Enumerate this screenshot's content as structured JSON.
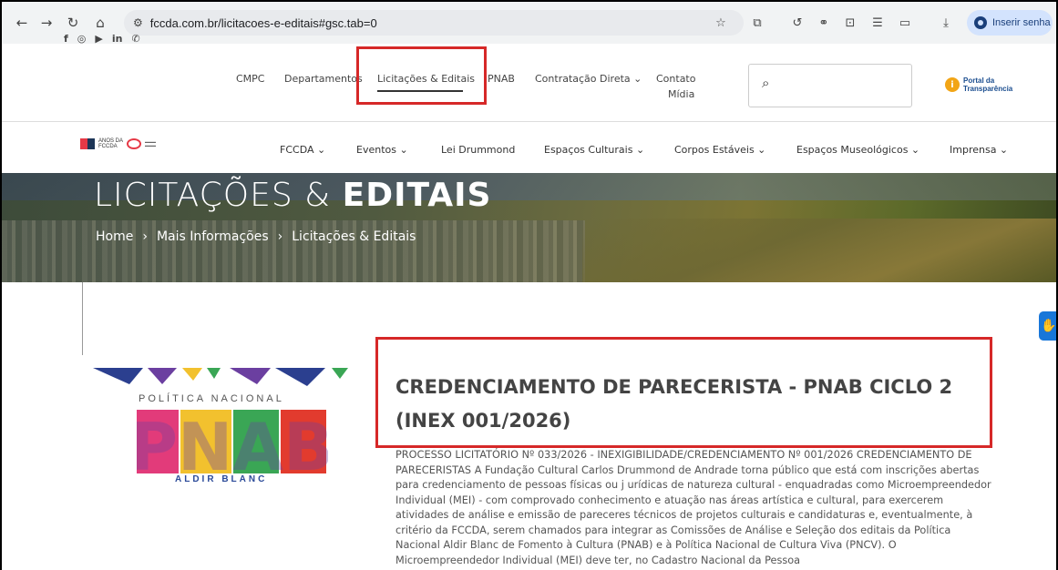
{
  "browser": {
    "url": "fccda.com.br/licitacoes-e-editais#gsc.tab=0",
    "password_button": "Inserir senha"
  },
  "header": {
    "top_links": [
      "CMPC",
      "Departamentos",
      "Licitações & Editais",
      "PNAB",
      "Contratação Direta",
      "Contato",
      "Mídia"
    ],
    "portal_line1": "Portal da",
    "portal_line2": "Transparência"
  },
  "logo": {
    "line1": "ANOS DA",
    "line2": "FCCDA"
  },
  "nav": {
    "items": [
      "FCCDA",
      "Eventos",
      "Lei Drummond",
      "Espaços Culturais",
      "Corpos Estáveis",
      "Espaços Museológicos",
      "Imprensa"
    ]
  },
  "hero": {
    "title_light": "LICITAÇÕES &",
    "title_bold": "EDITAIS",
    "breadcrumb": [
      "Home",
      "Mais Informações",
      "Licitações & Editais"
    ],
    "sep": "›"
  },
  "post": {
    "image_top": "POLÍTICA NACIONAL",
    "image_main": "PNAB",
    "image_sub": "ALDIR BLANC",
    "title": "CREDENCIAMENTO DE PARECERISTA - PNAB CICLO 2 (INEX 001/2026)",
    "body": "PROCESSO LICITATÓRIO Nº 033/2026 - INEXIGIBILIDADE/CREDENCIAMENTO Nº 001/2026 CREDENCIAMENTO DE PARECERISTAS A Fundação Cultural Carlos Drummond de Andrade torna público que está com inscrições abertas para credenciamento de pessoas físicas ou j urídicas de natureza cultural - enquadradas como Microempreendedor Individual (MEI) - com comprovado conhecimento e atuação nas áreas artística e cultural, para exercerem atividades de análise e emissão de pareceres técnicos de projetos culturais e candidaturas e, eventualmente, à critério da FCCDA, serem chamados para integrar as Comissões de Análise e Seleção dos editais da Política Nacional Aldir Blanc de Fomento à Cultura (PNAB) e à Política Nacional de Cultura Viva (PNCV). O Microempreendedor Individual (MEI) deve ter, no Cadastro Nacional da Pessoa"
  },
  "colors": {
    "highlight": "#d62828",
    "portal_blue": "#1a4d8f",
    "access_blue": "#1877d9"
  }
}
